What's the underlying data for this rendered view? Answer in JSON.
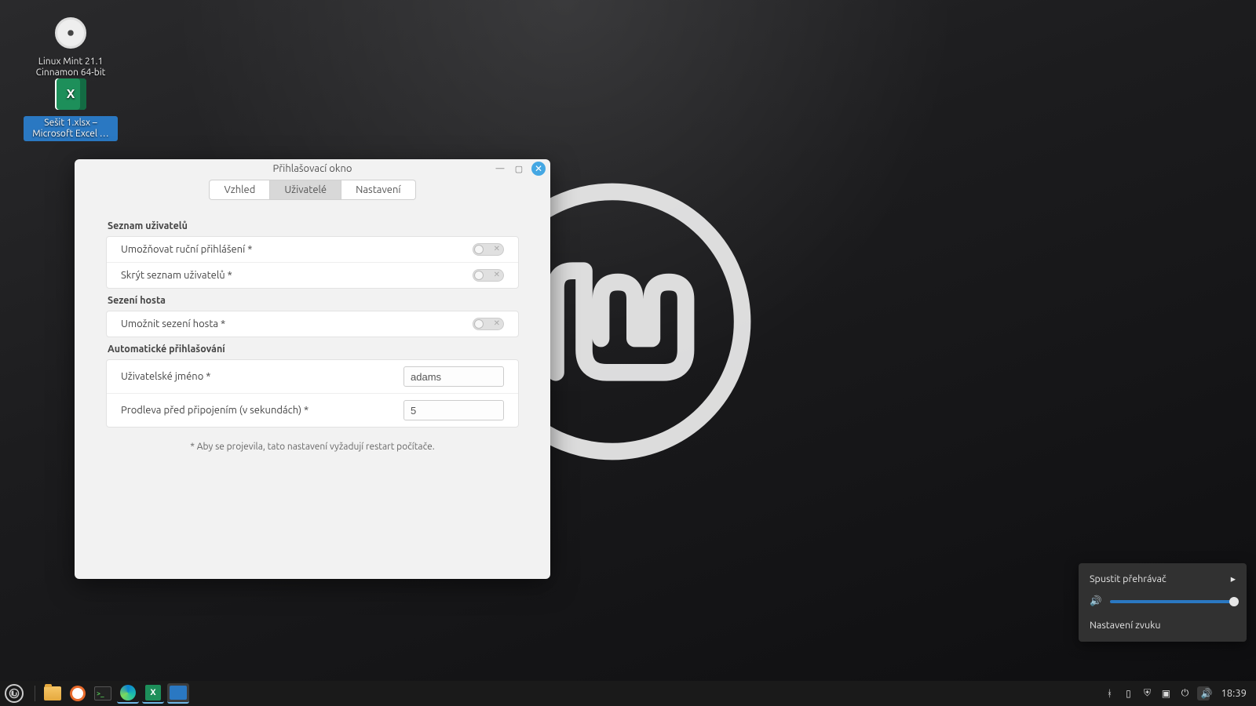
{
  "desktop": {
    "icons": [
      {
        "label": "Linux Mint 21.1\nCinnamon 64-bit",
        "icon": "disc"
      },
      {
        "label": "Sešit 1.xlsx – Microsoft Excel …",
        "icon": "excel",
        "selected": true
      }
    ]
  },
  "window": {
    "title": "Přihlašovací okno",
    "tabs": [
      {
        "label": "Vzhled",
        "active": false
      },
      {
        "label": "Uživatelé",
        "active": true
      },
      {
        "label": "Nastavení",
        "active": false
      }
    ],
    "sections": {
      "user_list": {
        "title": "Seznam uživatelů",
        "items": [
          {
            "label": "Umožňovat ruční přihlášení *",
            "value": false
          },
          {
            "label": "Skrýt seznam uživatelů *",
            "value": false
          }
        ]
      },
      "guest": {
        "title": "Sezení hosta",
        "items": [
          {
            "label": "Umožnit sezení hosta *",
            "value": false
          }
        ]
      },
      "auto": {
        "title": "Automatické přihlašování",
        "username_label": "Uživatelské jméno *",
        "username_value": "adams",
        "delay_label": "Prodleva před připojením (v sekundách) *",
        "delay_value": "5"
      }
    },
    "footnote": "* Aby se projevila, tato nastavení vyžadují restart počítače."
  },
  "sound_panel": {
    "launch_label": "Spustit přehrávač",
    "settings_label": "Nastavení zvuku",
    "volume_percent": 100
  },
  "panel": {
    "tasks": [
      {
        "name": "files",
        "icon": "folder"
      },
      {
        "name": "firefox",
        "icon": "fire"
      },
      {
        "name": "terminal",
        "icon": "term"
      },
      {
        "name": "edge",
        "icon": "edge",
        "active": true
      },
      {
        "name": "excel",
        "icon": "excel",
        "active": true
      },
      {
        "name": "settings-window",
        "icon": "win",
        "active": true
      }
    ],
    "clock": "18:39",
    "tray_icons": [
      "bluetooth",
      "battery",
      "shield",
      "display",
      "network",
      "sound"
    ]
  }
}
